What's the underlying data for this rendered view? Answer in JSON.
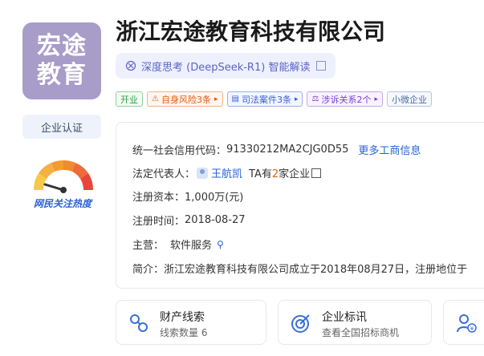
{
  "logo": {
    "line1": "宏途",
    "line2": "教育"
  },
  "cert_button": "企业认证",
  "heat_label": "网民关注热度",
  "company_name": "浙江宏途教育科技有限公司",
  "ai_chip": {
    "label": "深度思考 (DeepSeek-R1) 智能解读"
  },
  "tags": [
    {
      "label": "开业",
      "style": "green"
    },
    {
      "label": "自身风险3条",
      "style": "orange",
      "icon": "risk-icon"
    },
    {
      "label": "司法案件3条",
      "style": "blue",
      "icon": "document-icon"
    },
    {
      "label": "涉诉关系2个",
      "style": "purple",
      "icon": "gavel-icon"
    },
    {
      "label": "小微企业",
      "style": "gray"
    }
  ],
  "info": {
    "credit_code_label": "统一社会信用代码：",
    "credit_code": "91330212MA2CJG0D55",
    "more_info_link": "更多工商信息",
    "legal_rep_label": "法定代表人：",
    "legal_rep_name": "王航凯",
    "legal_rep_meta_prefix": "TA有",
    "legal_rep_meta_count": "2",
    "legal_rep_meta_suffix": "家企业",
    "capital_label": "注册资本：",
    "capital_value": "1,000万(元)",
    "date_label": "注册时间：",
    "date_value": "2018-08-27",
    "business_label": "主营：",
    "business_value": "软件服务",
    "intro_label": "简介：",
    "intro_text": "浙江宏途教育科技有限公司成立于2018年08月27日，注册地位于"
  },
  "bottom_cards": [
    {
      "title": "财产线索",
      "subtitle": "线索数量 6",
      "icon": "property-clue-icon"
    },
    {
      "title": "企业标讯",
      "subtitle": "查看全国招标商机",
      "icon": "bid-target-icon"
    },
    {
      "title": "",
      "subtitle": "",
      "icon": "yuan-person-icon"
    }
  ],
  "colors": {
    "logo_bg": "#a89cc8",
    "link": "#2a62d8",
    "ai_text": "#5b63c9",
    "heat_label": "#2a5fd8"
  }
}
